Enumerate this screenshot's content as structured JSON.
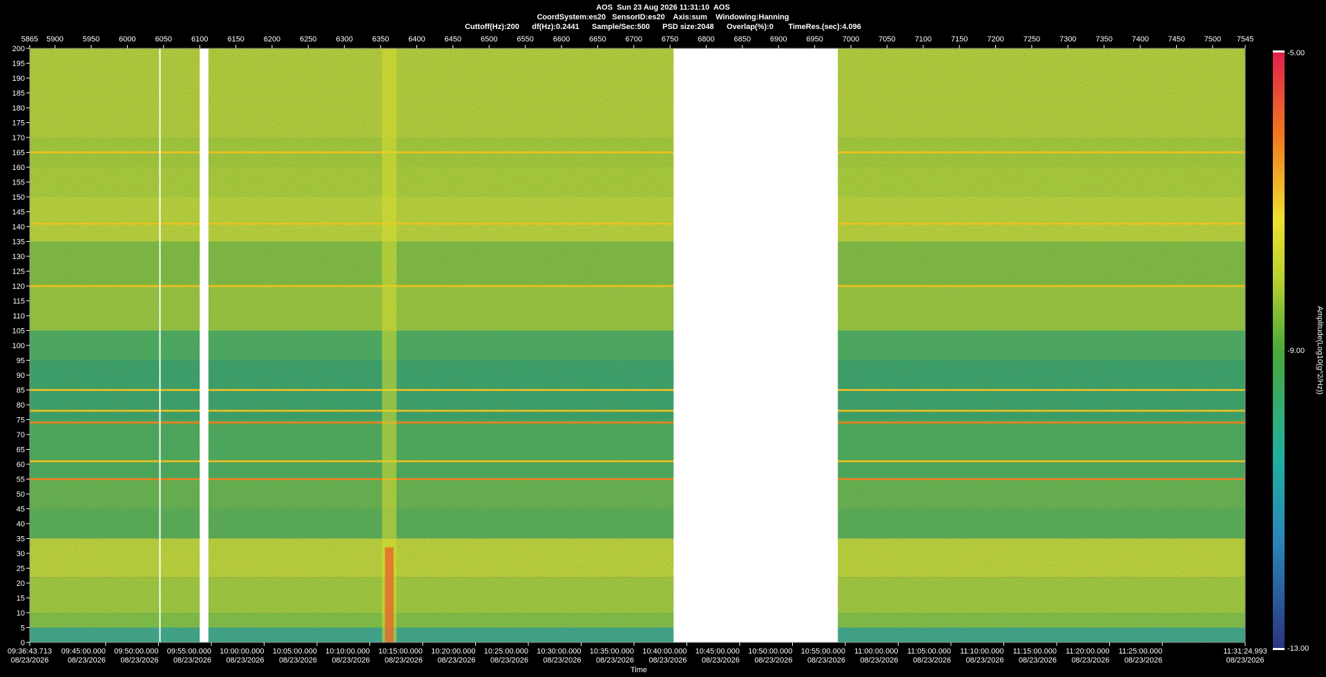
{
  "header": {
    "line1": "AOS  Sun 23 Aug 2026 11:31:10  AOS",
    "line2": "CoordSystem:es20   SensorID:es20    Axis:sum    Windowing:Hanning",
    "line3": "Cuttoff(Hz):200      df(Hz):0.2441      Sample/Sec:500      PSD size:2048      Overlap(%):0       TimeRes.(sec):4.096"
  },
  "chart_data": {
    "type": "heatmap",
    "xlabel": "Time",
    "ylabel": "",
    "top_axis": {
      "range": [
        5865,
        7545
      ],
      "ticks": [
        "5865",
        "5900",
        "5950",
        "6000",
        "6050",
        "6100",
        "6150",
        "6200",
        "6250",
        "6300",
        "6350",
        "6400",
        "6450",
        "6500",
        "6550",
        "6600",
        "6650",
        "6700",
        "6750",
        "6800",
        "6850",
        "6900",
        "6950",
        "7000",
        "7050",
        "7100",
        "7150",
        "7200",
        "7250",
        "7300",
        "7350",
        "7400",
        "7450",
        "7500",
        "7545"
      ]
    },
    "y_axis": {
      "range": [
        0,
        200
      ],
      "ticks": [
        "200",
        "195",
        "190",
        "185",
        "180",
        "175",
        "170",
        "165",
        "160",
        "155",
        "150",
        "145",
        "140",
        "135",
        "130",
        "125",
        "120",
        "115",
        "110",
        "105",
        "100",
        "95",
        "90",
        "85",
        "80",
        "75",
        "70",
        "65",
        "60",
        "55",
        "50",
        "45",
        "40",
        "35",
        "30",
        "25",
        "20",
        "15",
        "10",
        "5",
        "0"
      ]
    },
    "x_axis": {
      "ticks": [
        {
          "time": "09:36:43.713",
          "date": "08/23/2026"
        },
        {
          "time": "09:45:00.000",
          "date": "08/23/2026"
        },
        {
          "time": "09:50:00.000",
          "date": "08/23/2026"
        },
        {
          "time": "09:55:00.000",
          "date": "08/23/2026"
        },
        {
          "time": "10:00:00.000",
          "date": "08/23/2026"
        },
        {
          "time": "10:05:00.000",
          "date": "08/23/2026"
        },
        {
          "time": "10:10:00.000",
          "date": "08/23/2026"
        },
        {
          "time": "10:15:00.000",
          "date": "08/23/2026"
        },
        {
          "time": "10:20:00.000",
          "date": "08/23/2026"
        },
        {
          "time": "10:25:00.000",
          "date": "08/23/2026"
        },
        {
          "time": "10:30:00.000",
          "date": "08/23/2026"
        },
        {
          "time": "10:35:00.000",
          "date": "08/23/2026"
        },
        {
          "time": "10:40:00.000",
          "date": "08/23/2026"
        },
        {
          "time": "10:45:00.000",
          "date": "08/23/2026"
        },
        {
          "time": "10:50:00.000",
          "date": "08/23/2026"
        },
        {
          "time": "10:55:00.000",
          "date": "08/23/2026"
        },
        {
          "time": "11:00:00.000",
          "date": "08/23/2026"
        },
        {
          "time": "11:05:00.000",
          "date": "08/23/2026"
        },
        {
          "time": "11:10:00.000",
          "date": "08/23/2026"
        },
        {
          "time": "11:15:00.000",
          "date": "08/23/2026"
        },
        {
          "time": "11:20:00.000",
          "date": "08/23/2026"
        },
        {
          "time": "11:25:00.000",
          "date": "08/23/2026"
        },
        {
          "time": "11:31:24.993",
          "date": "08/23/2026"
        }
      ]
    },
    "colorbar": {
      "label": "Amplitude(Log10(g^2/Hz))",
      "max_label": "-5.00",
      "mid_label": "-9.00",
      "min_label": "-13.00",
      "range": [
        -13,
        -5
      ]
    },
    "data_gaps": [
      [
        6100,
        6112
      ],
      [
        6755,
        6982
      ]
    ],
    "narrowband_lines_hz": [
      165,
      141,
      120,
      85,
      78,
      74,
      61,
      55
    ],
    "colors": {
      "background_low": "#1f9e78",
      "background_high": "#c8d83a",
      "line": "#f0c020",
      "strong_line": "#f08020",
      "gap": "#ffffff"
    }
  }
}
